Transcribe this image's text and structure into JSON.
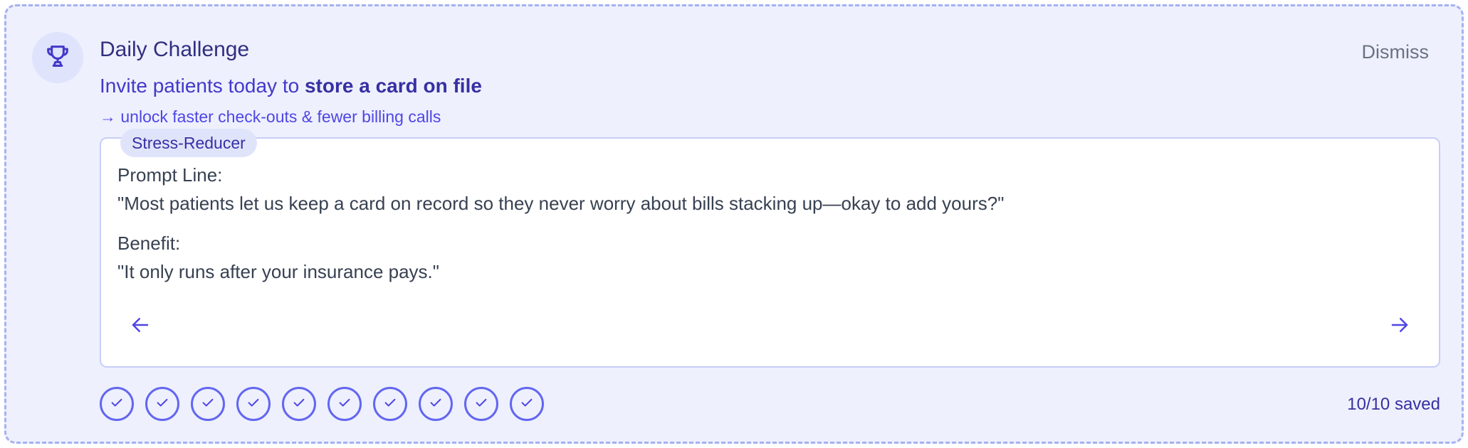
{
  "challenge": {
    "title": "Daily Challenge",
    "dismiss_label": "Dismiss",
    "invite_prefix": "Invite patients today to ",
    "invite_bold": "store a card on file",
    "unlock_text": "→ unlock faster check-outs & fewer billing calls"
  },
  "script_card": {
    "tag": "Stress-Reducer",
    "prompt_label": "Prompt Line:",
    "prompt_text": "\"Most patients let us keep a card on record so they never worry about bills stacking up—okay to add yours?\"",
    "benefit_label": "Benefit:",
    "benefit_text": "\"It only runs after your insurance pays.\""
  },
  "progress": {
    "completed": 10,
    "total": 10,
    "saved_label": "10/10 saved"
  },
  "icons": {
    "badge": "trophy-icon",
    "prev": "arrow-left-icon",
    "next": "arrow-right-icon",
    "step": "check-icon"
  },
  "colors": {
    "card_background": "#eef0fd",
    "card_border": "#a5b1f2",
    "accent": "#4f46e5",
    "title": "#312e81",
    "text": "#374151",
    "muted": "#6b7280"
  }
}
